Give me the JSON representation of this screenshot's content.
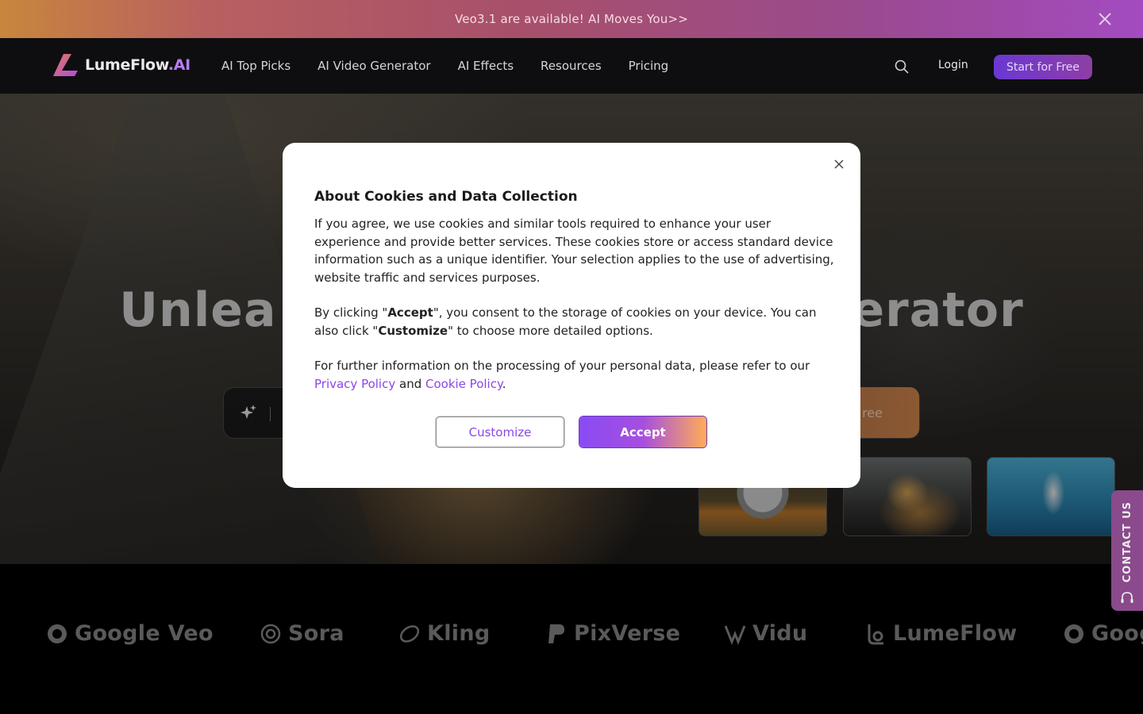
{
  "promo": {
    "text": "Veo3.1 are available! AI Moves You>>"
  },
  "nav": {
    "logo_main": "LumeFlow",
    "logo_suffix": ".AI",
    "links": [
      "AI Top Picks",
      "AI Video Generator",
      "AI Effects",
      "Resources",
      "Pricing"
    ],
    "login": "Login",
    "start": "Start for Free"
  },
  "hero": {
    "title_left": "Unlea",
    "title_right": "erator",
    "cta_partial": "ree"
  },
  "brands": [
    "Google Veo",
    "Sora",
    "Kling",
    "PixVerse",
    "Vidu",
    "LumeFlow",
    "Goog"
  ],
  "contact": {
    "label": "CONTACT US"
  },
  "modal": {
    "title": "About Cookies and Data Collection",
    "p1": "If you agree, we use cookies and similar tools required to enhance your user experience and provide better services. These cookies store or access standard device information such as a unique identifier. Your selection applies to the use of advertising, website traffic and services purposes.",
    "p2_a": "By clicking \"",
    "p2_accept": "Accept",
    "p2_b": "\", you consent to the storage of cookies on your device. You can also click \"",
    "p2_customize": "Customize",
    "p2_c": "\" to choose more detailed options.",
    "p3_a": "For further information on the processing of your personal data, please refer to our ",
    "privacy_link": "Privacy Policy",
    "p3_and": " and ",
    "cookie_link": "Cookie Policy",
    "p3_end": ".",
    "customize_button": "Customize",
    "accept_button": "Accept"
  },
  "colors": {
    "accent_purple": "#8b45e8",
    "accept_gradient_end": "#ffad56"
  }
}
